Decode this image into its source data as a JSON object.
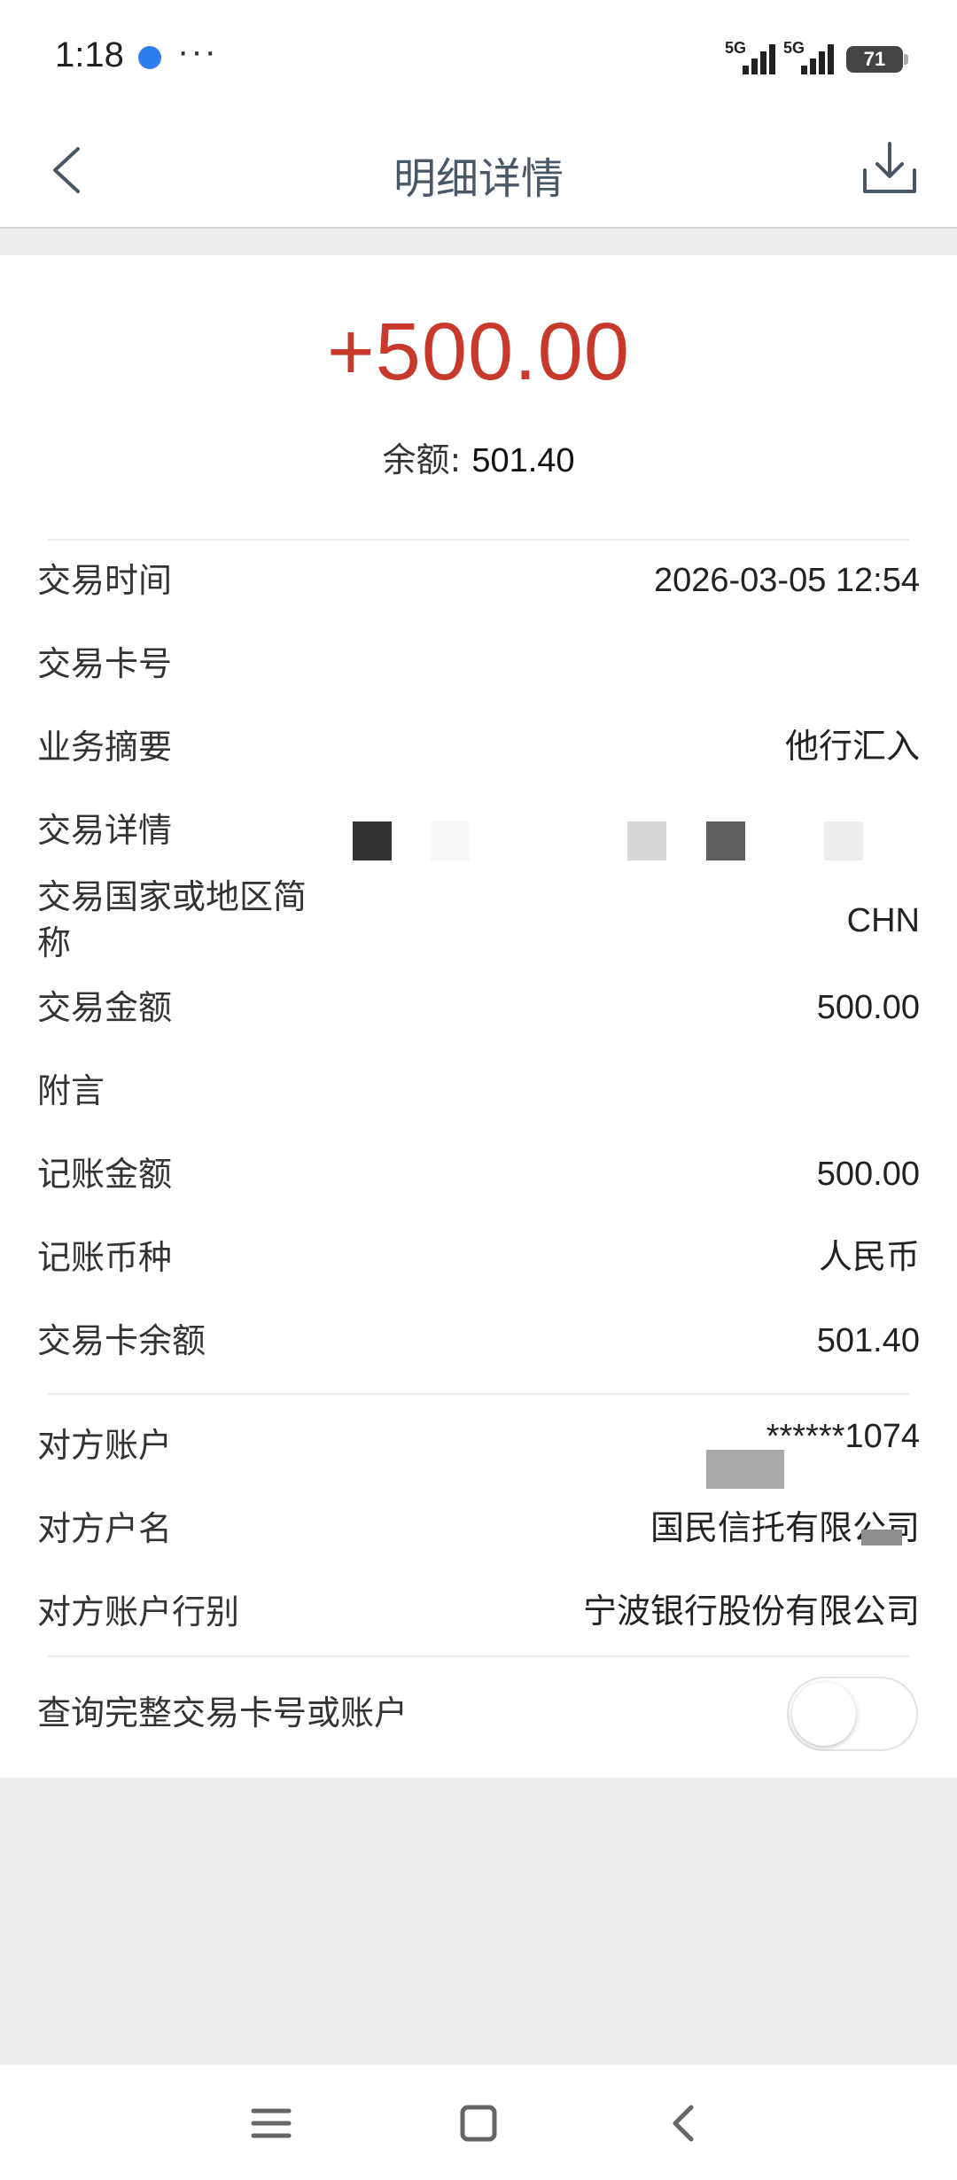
{
  "status_bar": {
    "time": "1:18",
    "more": "···",
    "signal_1": "5G",
    "signal_2": "5G",
    "battery": "71"
  },
  "nav": {
    "title": "明细详情",
    "back_icon": "chevron-left-icon",
    "download_icon": "download-icon"
  },
  "summary": {
    "amount": "+500.00",
    "balance_label": "余额: ",
    "balance_value": "501.40",
    "amount_color": "#c8392b"
  },
  "details": [
    {
      "label": "交易时间",
      "value": "2026-03-05 12:54"
    },
    {
      "label": "交易卡号",
      "value": ""
    },
    {
      "label": "业务摘要",
      "value": "他行汇入"
    },
    {
      "label": "交易详情",
      "value": ""
    },
    {
      "label": "交易国家或地区简称",
      "value": "CHN"
    },
    {
      "label": "交易金额",
      "value": "500.00"
    },
    {
      "label": "附言",
      "value": ""
    },
    {
      "label": "记账金额",
      "value": "500.00"
    },
    {
      "label": "记账币种",
      "value": "人民币"
    },
    {
      "label": "交易卡余额",
      "value": "501.40"
    }
  ],
  "counterparty": [
    {
      "label": "对方账户",
      "value": "******1074"
    },
    {
      "label": "对方户名",
      "value": "国民信托有限公司"
    },
    {
      "label": "对方账户行别",
      "value": "宁波银行股份有限公司"
    }
  ],
  "query_toggle": {
    "label": "查询完整交易卡号或账户",
    "state": "off"
  },
  "system_nav": {
    "menu_icon": "menu-icon",
    "home_icon": "home-square-icon",
    "back_icon": "back-chevron-icon"
  }
}
